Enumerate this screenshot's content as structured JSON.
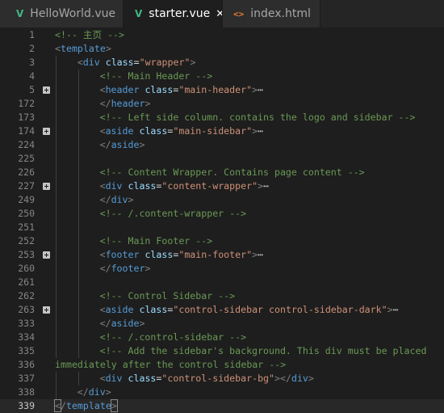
{
  "tabs": [
    {
      "label": "HelloWorld.vue",
      "icon": "vue-icon",
      "active": false
    },
    {
      "label": "starter.vue",
      "icon": "vue-icon",
      "active": true,
      "close_glyph": "✕"
    },
    {
      "label": "index.html",
      "icon": "html-icon",
      "active": false
    }
  ],
  "icons": {
    "vue": "V",
    "html": "<>"
  },
  "editor": {
    "current_line": "339",
    "lines": [
      {
        "num": "1",
        "indent": 0,
        "fold": false,
        "tokens": [
          {
            "t": "comment",
            "v": "<!-- 主页 -->"
          }
        ]
      },
      {
        "num": "2",
        "indent": 0,
        "fold": false,
        "tokens": [
          {
            "t": "bracket",
            "v": "<"
          },
          {
            "t": "tag",
            "v": "template"
          },
          {
            "t": "bracket",
            "v": ">"
          }
        ]
      },
      {
        "num": "3",
        "indent": 1,
        "fold": false,
        "tokens": [
          {
            "t": "bracket",
            "v": "<"
          },
          {
            "t": "tag",
            "v": "div"
          },
          {
            "t": "text",
            "v": " "
          },
          {
            "t": "attr",
            "v": "class"
          },
          {
            "t": "text",
            "v": "="
          },
          {
            "t": "string",
            "v": "\"wrapper\""
          },
          {
            "t": "bracket",
            "v": ">"
          }
        ]
      },
      {
        "num": "4",
        "indent": 2,
        "fold": false,
        "tokens": [
          {
            "t": "comment",
            "v": "<!-- Main Header -->"
          }
        ]
      },
      {
        "num": "5",
        "indent": 2,
        "fold": true,
        "tokens": [
          {
            "t": "bracket",
            "v": "<"
          },
          {
            "t": "tag",
            "v": "header"
          },
          {
            "t": "text",
            "v": " "
          },
          {
            "t": "attr",
            "v": "class"
          },
          {
            "t": "text",
            "v": "="
          },
          {
            "t": "string",
            "v": "\"main-header\""
          },
          {
            "t": "bracket",
            "v": ">"
          },
          {
            "t": "ellipsis",
            "v": "⋯"
          }
        ]
      },
      {
        "num": "172",
        "indent": 2,
        "fold": false,
        "tokens": [
          {
            "t": "bracket",
            "v": "</"
          },
          {
            "t": "tag",
            "v": "header"
          },
          {
            "t": "bracket",
            "v": ">"
          }
        ]
      },
      {
        "num": "173",
        "indent": 2,
        "fold": false,
        "tokens": [
          {
            "t": "comment",
            "v": "<!-- Left side column. contains the logo and sidebar -->"
          }
        ]
      },
      {
        "num": "174",
        "indent": 2,
        "fold": true,
        "tokens": [
          {
            "t": "bracket",
            "v": "<"
          },
          {
            "t": "tag",
            "v": "aside"
          },
          {
            "t": "text",
            "v": " "
          },
          {
            "t": "attr",
            "v": "class"
          },
          {
            "t": "text",
            "v": "="
          },
          {
            "t": "string",
            "v": "\"main-sidebar\""
          },
          {
            "t": "bracket",
            "v": ">"
          },
          {
            "t": "ellipsis",
            "v": "⋯"
          }
        ]
      },
      {
        "num": "224",
        "indent": 2,
        "fold": false,
        "tokens": [
          {
            "t": "bracket",
            "v": "</"
          },
          {
            "t": "tag",
            "v": "aside"
          },
          {
            "t": "bracket",
            "v": ">"
          }
        ]
      },
      {
        "num": "225",
        "indent": 2,
        "fold": false,
        "tokens": []
      },
      {
        "num": "226",
        "indent": 2,
        "fold": false,
        "tokens": [
          {
            "t": "comment",
            "v": "<!-- Content Wrapper. Contains page content -->"
          }
        ]
      },
      {
        "num": "227",
        "indent": 2,
        "fold": true,
        "tokens": [
          {
            "t": "bracket",
            "v": "<"
          },
          {
            "t": "tag",
            "v": "div"
          },
          {
            "t": "text",
            "v": " "
          },
          {
            "t": "attr",
            "v": "class"
          },
          {
            "t": "text",
            "v": "="
          },
          {
            "t": "string",
            "v": "\"content-wrapper\""
          },
          {
            "t": "bracket",
            "v": ">"
          },
          {
            "t": "ellipsis",
            "v": "⋯"
          }
        ]
      },
      {
        "num": "249",
        "indent": 2,
        "fold": false,
        "tokens": [
          {
            "t": "bracket",
            "v": "</"
          },
          {
            "t": "tag",
            "v": "div"
          },
          {
            "t": "bracket",
            "v": ">"
          }
        ]
      },
      {
        "num": "250",
        "indent": 2,
        "fold": false,
        "tokens": [
          {
            "t": "comment",
            "v": "<!-- /.content-wrapper -->"
          }
        ]
      },
      {
        "num": "251",
        "indent": 2,
        "fold": false,
        "tokens": []
      },
      {
        "num": "252",
        "indent": 2,
        "fold": false,
        "tokens": [
          {
            "t": "comment",
            "v": "<!-- Main Footer -->"
          }
        ]
      },
      {
        "num": "253",
        "indent": 2,
        "fold": true,
        "tokens": [
          {
            "t": "bracket",
            "v": "<"
          },
          {
            "t": "tag",
            "v": "footer"
          },
          {
            "t": "text",
            "v": " "
          },
          {
            "t": "attr",
            "v": "class"
          },
          {
            "t": "text",
            "v": "="
          },
          {
            "t": "string",
            "v": "\"main-footer\""
          },
          {
            "t": "bracket",
            "v": ">"
          },
          {
            "t": "ellipsis",
            "v": "⋯"
          }
        ]
      },
      {
        "num": "260",
        "indent": 2,
        "fold": false,
        "tokens": [
          {
            "t": "bracket",
            "v": "</"
          },
          {
            "t": "tag",
            "v": "footer"
          },
          {
            "t": "bracket",
            "v": ">"
          }
        ]
      },
      {
        "num": "261",
        "indent": 2,
        "fold": false,
        "tokens": []
      },
      {
        "num": "262",
        "indent": 2,
        "fold": false,
        "tokens": [
          {
            "t": "comment",
            "v": "<!-- Control Sidebar -->"
          }
        ]
      },
      {
        "num": "263",
        "indent": 2,
        "fold": true,
        "tokens": [
          {
            "t": "bracket",
            "v": "<"
          },
          {
            "t": "tag",
            "v": "aside"
          },
          {
            "t": "text",
            "v": " "
          },
          {
            "t": "attr",
            "v": "class"
          },
          {
            "t": "text",
            "v": "="
          },
          {
            "t": "string",
            "v": "\"control-sidebar control-sidebar-dark\""
          },
          {
            "t": "bracket",
            "v": ">"
          },
          {
            "t": "ellipsis",
            "v": "⋯"
          }
        ]
      },
      {
        "num": "333",
        "indent": 2,
        "fold": false,
        "tokens": [
          {
            "t": "bracket",
            "v": "</"
          },
          {
            "t": "tag",
            "v": "aside"
          },
          {
            "t": "bracket",
            "v": ">"
          }
        ]
      },
      {
        "num": "334",
        "indent": 2,
        "fold": false,
        "tokens": [
          {
            "t": "comment",
            "v": "<!-- /.control-sidebar -->"
          }
        ]
      },
      {
        "num": "335",
        "indent": 2,
        "fold": false,
        "tokens": [
          {
            "t": "comment",
            "v": "<!-- Add the sidebar's background. This div must be placed"
          }
        ]
      },
      {
        "num": "336",
        "indent": 0,
        "fold": false,
        "tokens": [
          {
            "t": "comment",
            "v": "immediately after the control sidebar -->"
          }
        ]
      },
      {
        "num": "337",
        "indent": 2,
        "fold": false,
        "tokens": [
          {
            "t": "bracket",
            "v": "<"
          },
          {
            "t": "tag",
            "v": "div"
          },
          {
            "t": "text",
            "v": " "
          },
          {
            "t": "attr",
            "v": "class"
          },
          {
            "t": "text",
            "v": "="
          },
          {
            "t": "string",
            "v": "\"control-sidebar-bg\""
          },
          {
            "t": "bracket",
            "v": "></"
          },
          {
            "t": "tag",
            "v": "div"
          },
          {
            "t": "bracket",
            "v": ">"
          }
        ]
      },
      {
        "num": "338",
        "indent": 1,
        "fold": false,
        "tokens": [
          {
            "t": "bracket",
            "v": "</"
          },
          {
            "t": "tag",
            "v": "div"
          },
          {
            "t": "bracket",
            "v": ">"
          }
        ]
      },
      {
        "num": "339",
        "indent": 0,
        "fold": false,
        "tokens": [
          {
            "t": "bracket",
            "v": "<",
            "hl": true
          },
          {
            "t": "bracket",
            "v": "/"
          },
          {
            "t": "tag",
            "v": "template"
          },
          {
            "t": "bracket",
            "v": ">",
            "hl": true
          }
        ]
      }
    ]
  }
}
